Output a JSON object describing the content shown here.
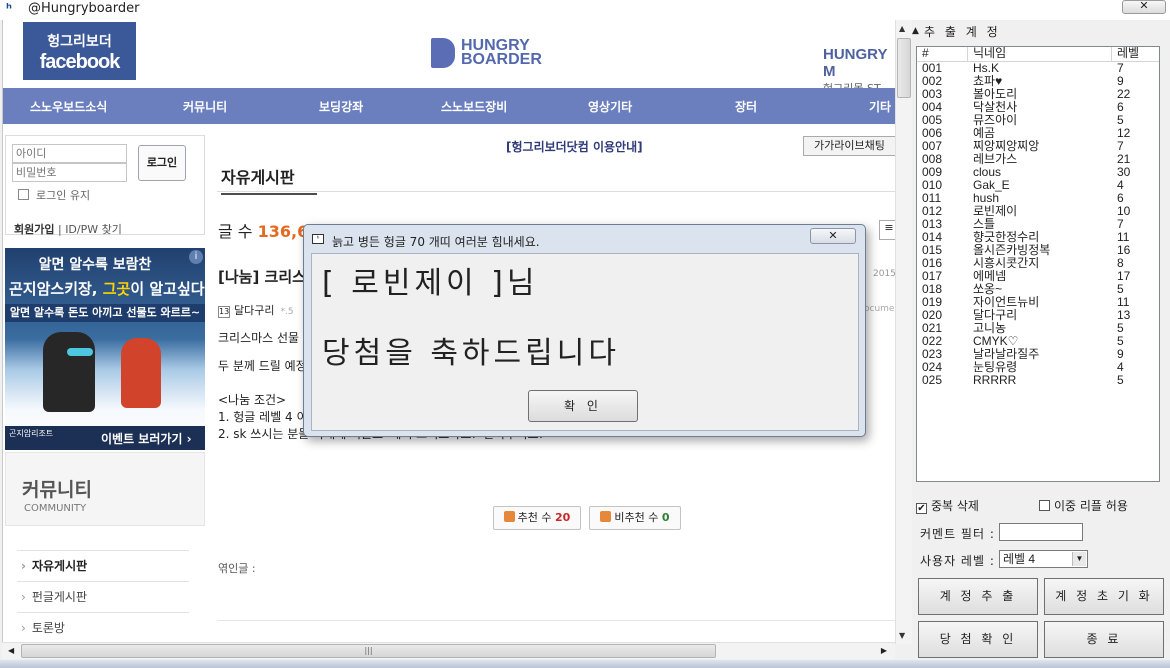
{
  "window": {
    "title": "@Hungryboarder",
    "close_glyph": "✕"
  },
  "web": {
    "fb_logo_ko": "헝그리보더",
    "fb_logo_en": "facebook",
    "brand_l1": "HUNGRY",
    "brand_l2": "BOARDER",
    "store_l1": "HUNGRY M",
    "store_l2": "헝그리몰 ST",
    "nav": [
      "스노우보드소식",
      "커뮤니티",
      "보딩강좌",
      "스노보드장비",
      "영상기타",
      "장터",
      "기타"
    ],
    "login": {
      "id_placeholder": "아이디",
      "pw_placeholder": "비밀번호",
      "button": "로그인",
      "keep": "로그인 유지",
      "join": "회원가입",
      "find": "ID/PW 찾기"
    },
    "ad": {
      "line1": "알면 알수록 보람찬",
      "line2a": "곤지암스키장,",
      "line2b": "그곳",
      "line2c": "이 알고싶다",
      "line3": "알면 알수록 돈도 아끼고 선물도 와르르~",
      "resort": "곤지암리조트",
      "event": "이벤트 보러가기 ›"
    },
    "community_ko": "커뮤니티",
    "community_en": "COMMUNITY",
    "menu": [
      "자유게시판",
      "펀글게시판",
      "토론방"
    ],
    "guide": "[헝그리보더닷컴 이용안내]",
    "chat": "가가라이브채팅",
    "board_title": "자유게시판",
    "count_label": "글 수",
    "count_value": "136,66",
    "post_title": "[나눔] 크리스",
    "post_date": "2015.",
    "author": "달다구리",
    "author_level": "13",
    "author_rest": "*.5",
    "author_right": "ocument",
    "body": [
      "크리스마스 선물",
      "두 분께 드릴 예정",
      "<나눔 조건>",
      "1. 헝글 레벨 4 이",
      "2. sk 쓰시는 분들 아래에 리플로 '메리 크리스마스!' 달아주셔요!"
    ],
    "like_label": "추천 수",
    "like_value": "20",
    "dislike_label": "비추천 수",
    "dislike_value": "0",
    "related": "엮인글 :"
  },
  "panel": {
    "title": "추 출 계 정",
    "columns": [
      "#",
      "닉네임",
      "레벨"
    ],
    "rows": [
      [
        "001",
        "Hs.K",
        "7"
      ],
      [
        "002",
        "쵸파♥",
        "9"
      ],
      [
        "003",
        "볼아도리",
        "22"
      ],
      [
        "004",
        "닥살천사",
        "6"
      ],
      [
        "005",
        "뮤즈아이",
        "5"
      ],
      [
        "006",
        "예곰",
        "12"
      ],
      [
        "007",
        "찌앙찌앙찌앙",
        "7"
      ],
      [
        "008",
        "레브가스",
        "21"
      ],
      [
        "009",
        "clous",
        "30"
      ],
      [
        "010",
        "Gak_E",
        "4"
      ],
      [
        "011",
        "hush",
        "6"
      ],
      [
        "012",
        "로빈제이",
        "10"
      ],
      [
        "013",
        "스틀",
        "7"
      ],
      [
        "014",
        "향긋한정수리",
        "11"
      ],
      [
        "015",
        "올시즌카빙정복",
        "16"
      ],
      [
        "016",
        "시흥시콧간지",
        "8"
      ],
      [
        "017",
        "에메넴",
        "17"
      ],
      [
        "018",
        "쏘옹~",
        "5"
      ],
      [
        "019",
        "자이언트뉴비",
        "11"
      ],
      [
        "020",
        "달다구리",
        "13"
      ],
      [
        "021",
        "고니농",
        "5"
      ],
      [
        "022",
        "CMYK♡",
        "5"
      ],
      [
        "023",
        "날라날라질주",
        "9"
      ],
      [
        "024",
        "눈팅유령",
        "4"
      ],
      [
        "025",
        "RRRRR",
        "5"
      ]
    ],
    "dup_delete": "중복 삭제",
    "dup_delete_checked": true,
    "double_reply": "이중 리플 허용",
    "double_reply_checked": false,
    "comment_filter_label": "커멘트 필터 :",
    "comment_filter_value": "",
    "user_level_label": "사용자 레벨 :",
    "user_level_value": "레벨 4",
    "btn_extract": "계 정 추 출",
    "btn_reset": "계 정 초 기 화",
    "btn_confirm": "당 첨 확 인",
    "btn_exit": "종 료"
  },
  "dialog": {
    "title": "늙고 병든 헝글 70 개띠 여러분 힘내세요.",
    "line1": "[ 로빈제이 ]님",
    "line2": "당첨을 축하드립니다",
    "ok": "확 인",
    "close_glyph": "✕"
  },
  "icons": {
    "app": "hungryboarder-app-icon",
    "close": "close-icon",
    "dropdown": "chevron-down-icon"
  }
}
